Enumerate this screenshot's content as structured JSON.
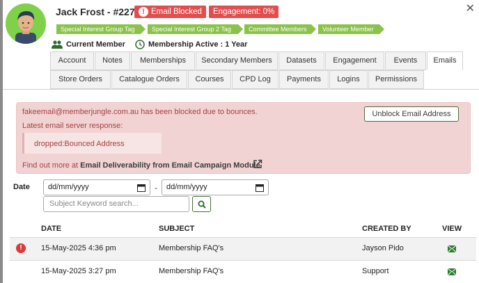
{
  "member": {
    "name": "Jack Frost - #2277",
    "email_blocked_badge": "Email Blocked",
    "engagement_badge": "Engagement: 0%",
    "tags": [
      "Special Interest Group Tag",
      "Special Interest Group 2 Tag",
      "Committee Members",
      "Volunteer Member"
    ],
    "status_current": "Current Member",
    "status_active": "Membership Active : 1 Year"
  },
  "tabs_row1": [
    "Account",
    "Notes",
    "Memberships",
    "Secondary Members",
    "Datasets",
    "Engagement",
    "Events",
    "Emails"
  ],
  "tabs_row2": [
    "Store Orders",
    "Catalogue Orders",
    "Courses",
    "CPD Log",
    "Payments",
    "Logins",
    "Permissions"
  ],
  "active_tab": "Emails",
  "alert": {
    "message": "fakeemail@memberjungle.com.au has been blocked due to bounces.",
    "response_label": "Latest email server response:",
    "response": "dropped:Bounced Address",
    "find_more_prefix": "Find out more at ",
    "find_more_link": "Email Deliverability from Email Campaign Module",
    "unblock_button": "Unblock Email Address"
  },
  "filters": {
    "date_label": "Date",
    "date_from_placeholder": "dd/mm/yyyy",
    "date_separator": "-",
    "date_to_placeholder": "dd/mm/yyyy",
    "search_placeholder": "Subject Keyword search..."
  },
  "table": {
    "headers": {
      "date": "DATE",
      "subject": "SUBJECT",
      "created_by": "CREATED BY",
      "view": "VIEW"
    },
    "rows": [
      {
        "date": "15-May-2025 4:36 pm",
        "subject": "Membership FAQ's",
        "created_by": "Jayson Pido",
        "error": "!"
      },
      {
        "date": "15-May-2025 3:27 pm",
        "subject": "Membership FAQ's",
        "created_by": "Support"
      }
    ]
  },
  "colors": {
    "accent_green": "#8bc34a",
    "danger_red": "#e34d4d",
    "alert_bg": "#f2d3d3",
    "alert_text": "#a44141"
  }
}
